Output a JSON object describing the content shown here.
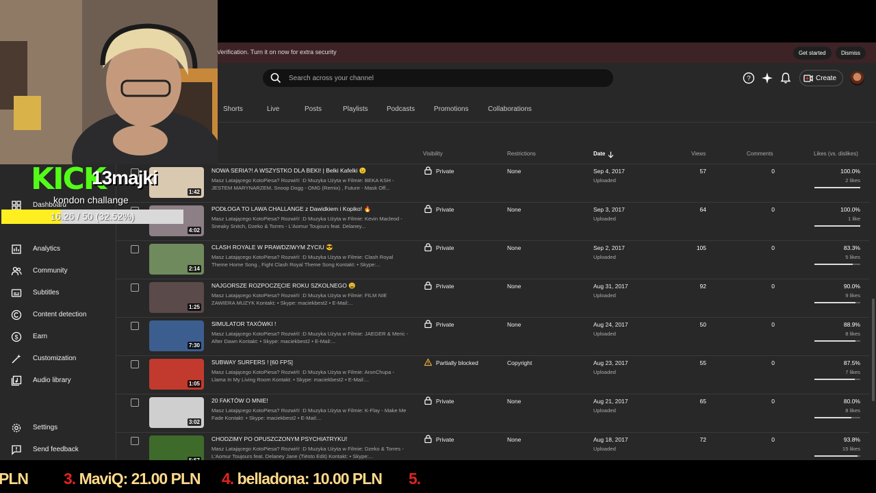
{
  "banner": {
    "text": "Verification. Turn it on now for extra security",
    "get_started": "Get started",
    "dismiss": "Dismiss"
  },
  "search": {
    "placeholder": "Search across your channel"
  },
  "header": {
    "create_label": "Create"
  },
  "tabs": [
    "Shorts",
    "Live",
    "Posts",
    "Playlists",
    "Podcasts",
    "Promotions",
    "Collaborations"
  ],
  "sidebar": {
    "items": [
      {
        "label": "Dashboard",
        "icon": "dashboard-icon"
      },
      {
        "label": "Analytics",
        "icon": "analytics-icon"
      },
      {
        "label": "Community",
        "icon": "community-icon"
      },
      {
        "label": "Subtitles",
        "icon": "subtitles-icon"
      },
      {
        "label": "Content detection",
        "icon": "copyright-icon"
      },
      {
        "label": "Earn",
        "icon": "dollar-icon"
      },
      {
        "label": "Customization",
        "icon": "wand-icon"
      },
      {
        "label": "Audio library",
        "icon": "audio-library-icon"
      }
    ],
    "settings": "Settings",
    "feedback": "Send feedback"
  },
  "table": {
    "headers": {
      "visibility": "Visibility",
      "restrictions": "Restrictions",
      "date": "Date",
      "views": "Views",
      "comments": "Comments",
      "likes": "Likes (vs. dislikes)"
    },
    "rows": [
      {
        "title": "NOWA SERIA?! A WSZYSTKO DLA BEKI! | Belki Kafelki 😉",
        "desc": "Masz Latającego KotoPiesa? Rozwiń! :D Muzyka Użyta w Filmie: BEKA KSH - JESTEM MARYNARZEM, Snoop Dogg - OMG (Remix) , Future - Mask Off...",
        "duration": "1:42",
        "visibility": "Private",
        "restrictions": "None",
        "date": "Sep 4, 2017",
        "date_sub": "Uploaded",
        "views": "57",
        "comments": "0",
        "likes_pct": "100.0%",
        "likes_count": "2 likes",
        "ratio": 1.0,
        "thumb": "#d9c9b0"
      },
      {
        "title": "PODŁOGA TO LAWA CHALLANGE z Dawidkiem i Kopiko! 🔥",
        "desc": "Masz Latającego KotoPiesa? Rozwiń! :D Muzyka Użyta w Filmie: Kevin Macleod - Sneaky Snitch, Dzeko & Torres - L'Aomur Toujours feat. Delaney...",
        "duration": "4:02",
        "visibility": "Private",
        "restrictions": "None",
        "date": "Sep 3, 2017",
        "date_sub": "Uploaded",
        "views": "64",
        "comments": "0",
        "likes_pct": "100.0%",
        "likes_count": "1 like",
        "ratio": 1.0,
        "thumb": "#8d7f86"
      },
      {
        "title": "CLASH ROYALE W PRAWDZIWYM ŻYCIU 😎",
        "desc": "Masz Latającego KotoPiesa? Rozwiń! :D Muzyka Użyta w Filmie: Clash Royal Theme Home Song , Fight Clash Royal Theme Song Kontakt: • Skype:...",
        "duration": "2:14",
        "visibility": "Private",
        "restrictions": "None",
        "date": "Sep 2, 2017",
        "date_sub": "Uploaded",
        "views": "105",
        "comments": "0",
        "likes_pct": "83.3%",
        "likes_count": "5 likes",
        "ratio": 0.833,
        "thumb": "#6f8a5c"
      },
      {
        "title": "NAJGORSZE ROZPOCZĘCIE ROKU SZKOLNEGO 😩",
        "desc": "Masz Latającego KotoPiesa? Rozwiń! :D Muzyka Użyta w Filmie: FILM NIE ZAWIERA MUZYK Kontakt: • Skype: maciekbest2 • E-Mail:...",
        "duration": "1:25",
        "visibility": "Private",
        "restrictions": "None",
        "date": "Aug 31, 2017",
        "date_sub": "Uploaded",
        "views": "92",
        "comments": "0",
        "likes_pct": "90.0%",
        "likes_count": "9 likes",
        "ratio": 0.9,
        "thumb": "#5b4a4a"
      },
      {
        "title": "SIMULATOR TAXÓWKI !",
        "desc": "Masz Latającego KotoPiesa? Rozwiń! :D Muzyka Użyta w Filmie: JAEGER & Meric - After Dawn Kontakt: • Skype: maciekbest2 • E-Mail:...",
        "duration": "7:30",
        "visibility": "Private",
        "restrictions": "None",
        "date": "Aug 24, 2017",
        "date_sub": "Uploaded",
        "views": "50",
        "comments": "0",
        "likes_pct": "88.9%",
        "likes_count": "8 likes",
        "ratio": 0.889,
        "thumb": "#3c5e8e"
      },
      {
        "title": "SUBWAY SURFERS ! [60 FPS]",
        "desc": "Masz Latającego KotoPiesa? Rozwiń! :D Muzyka Użyta w Filmie: AronChupa - Llama In My Living Room Kontakt: • Skype: maciekbest2 • E-Mail:...",
        "duration": "1:05",
        "visibility": "Partially blocked",
        "restrictions": "Copyright",
        "date": "Aug 23, 2017",
        "date_sub": "Uploaded",
        "views": "55",
        "comments": "0",
        "likes_pct": "87.5%",
        "likes_count": "7 likes",
        "ratio": 0.875,
        "thumb": "#c23a2e"
      },
      {
        "title": "20 FAKTÓW O MNIE!",
        "desc": "Masz Latającego KotoPiesa? Rozwiń! :D Muzyka Użyta w Filmie: K-Flay - Make Me Fade Kontakt: • Skype: maciekbest2 • E-Mail:...",
        "duration": "3:02",
        "visibility": "Private",
        "restrictions": "None",
        "date": "Aug 21, 2017",
        "date_sub": "Uploaded",
        "views": "65",
        "comments": "0",
        "likes_pct": "80.0%",
        "likes_count": "8 likes",
        "ratio": 0.8,
        "thumb": "#cfcfcf"
      },
      {
        "title": "CHODZIMY PO OPUSZCZONYM PSYCHIATRYKU!",
        "desc": "Masz Latającego KotoPiesa? Rozwiń! :D Muzyka Użyta w Filmie: Dzeko & Torres - L'Aomur Toujours feat. Delaney Jane (Tiësto Edit) Kontakt: • Skype:...",
        "duration": "5:57",
        "visibility": "Private",
        "restrictions": "None",
        "date": "Aug 18, 2017",
        "date_sub": "Uploaded",
        "views": "72",
        "comments": "0",
        "likes_pct": "93.8%",
        "likes_count": "15 likes",
        "ratio": 0.938,
        "thumb": "#3f6b2a"
      }
    ]
  },
  "overlay": {
    "kick_logo": "KICK",
    "kick_user": "13majki",
    "goal_label": "kondon challange",
    "goal_text": "16.26 / 50 (32.52%)",
    "goal_fraction": 0.3252,
    "ticker": [
      {
        "num": "",
        "name": "",
        "amount": "PLN"
      },
      {
        "num": "3.",
        "name": "MaviQ:",
        "amount": "21.00 PLN"
      },
      {
        "num": "4.",
        "name": "belladona:",
        "amount": "10.00 PLN"
      },
      {
        "num": "5.",
        "name": "",
        "amount": ""
      }
    ]
  }
}
